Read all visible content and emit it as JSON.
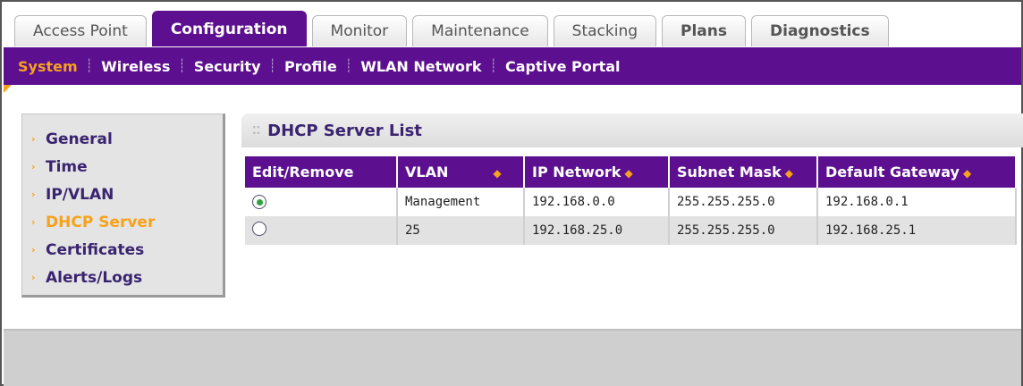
{
  "tabs": [
    {
      "label": "Access Point"
    },
    {
      "label": "Configuration"
    },
    {
      "label": "Monitor"
    },
    {
      "label": "Maintenance"
    },
    {
      "label": "Stacking"
    },
    {
      "label": "Plans"
    },
    {
      "label": "Diagnostics"
    }
  ],
  "subnav": [
    {
      "label": "System"
    },
    {
      "label": "Wireless"
    },
    {
      "label": "Security"
    },
    {
      "label": "Profile"
    },
    {
      "label": "WLAN Network"
    },
    {
      "label": "Captive Portal"
    }
  ],
  "sidemenu": [
    {
      "label": "General"
    },
    {
      "label": "Time"
    },
    {
      "label": "IP/VLAN"
    },
    {
      "label": "DHCP Server"
    },
    {
      "label": "Certificates"
    },
    {
      "label": "Alerts/Logs"
    }
  ],
  "panel": {
    "title": "DHCP Server List",
    "columns": [
      "Edit/Remove",
      "VLAN",
      "IP Network",
      "Subnet Mask",
      "Default Gateway"
    ],
    "rows": [
      {
        "selected": true,
        "vlan": "Management",
        "ip": "192.168.0.0",
        "mask": "255.255.255.0",
        "gateway": "192.168.0.1"
      },
      {
        "selected": false,
        "vlan": "25",
        "ip": "192.168.25.0",
        "mask": "255.255.255.0",
        "gateway": "192.168.25.1"
      }
    ]
  },
  "colors": {
    "brand_purple": "#5c0f8f",
    "accent_orange": "#f7a21b",
    "selected_radio": "#2fa33b"
  }
}
